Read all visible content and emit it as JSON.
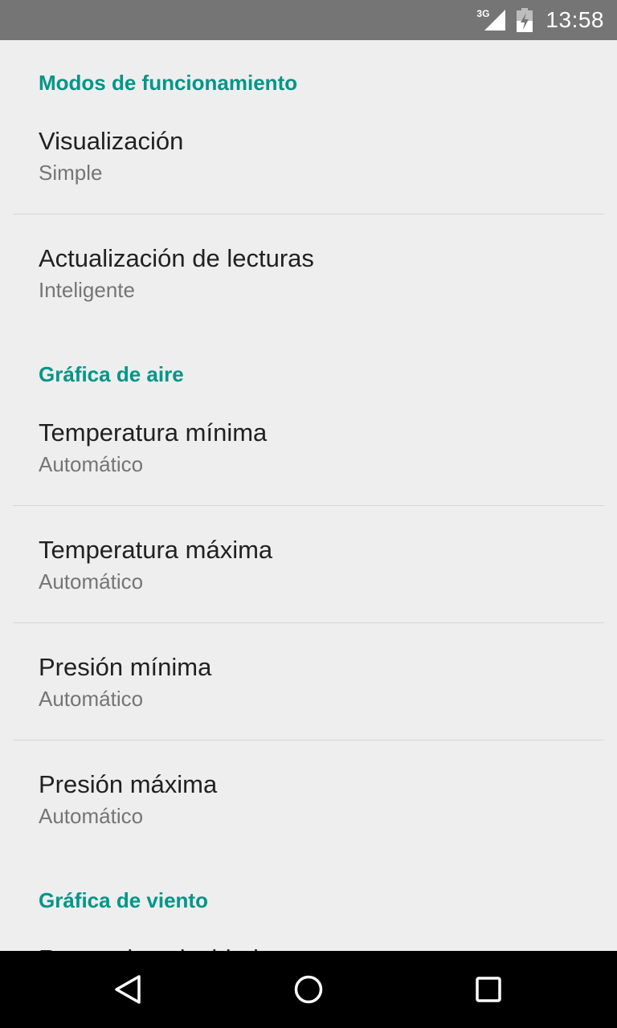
{
  "status_bar": {
    "network_label": "3G",
    "time": "13:58",
    "icons": [
      "signal-icon",
      "battery-charging-icon"
    ]
  },
  "sections": [
    {
      "header": "Modos de funcionamiento",
      "items": [
        {
          "title": "Visualización",
          "summary": "Simple"
        },
        {
          "title": "Actualización de lecturas",
          "summary": "Inteligente"
        }
      ]
    },
    {
      "header": "Gráfica de aire",
      "items": [
        {
          "title": "Temperatura mínima",
          "summary": "Automático"
        },
        {
          "title": "Temperatura máxima",
          "summary": "Automático"
        },
        {
          "title": "Presión mínima",
          "summary": "Automático"
        },
        {
          "title": "Presión máxima",
          "summary": "Automático"
        }
      ]
    },
    {
      "header": "Gráfica de viento",
      "items": [
        {
          "title": "Rango de velocidad",
          "summary": ""
        }
      ]
    }
  ],
  "nav_bar": {
    "icons": [
      "back-icon",
      "home-icon",
      "recents-icon"
    ]
  },
  "colors": {
    "accent": "#009688",
    "status_bar": "#757575",
    "background": "#eeeeee",
    "title_text": "#212121",
    "summary_text": "#757575"
  }
}
